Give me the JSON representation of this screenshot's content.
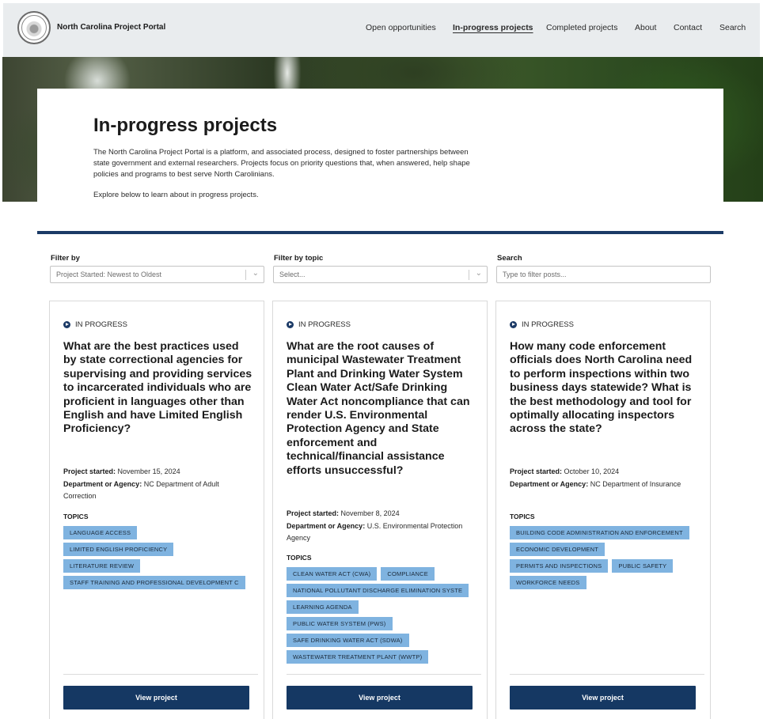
{
  "header": {
    "brand": "North Carolina Project Portal",
    "nav": [
      "Open opportunities",
      "In-progress projects",
      "Completed projects",
      "About",
      "Contact",
      "Search"
    ],
    "active_nav": "In-progress projects"
  },
  "hero": {
    "title": "In-progress projects",
    "description": "The North Carolina Project Portal is a platform, and associated process, designed to foster partnerships between state government and external researchers. Projects focus on priority questions that, when answered, help shape policies and programs to best serve North Carolinians.",
    "explore": "Explore below to learn about in progress projects."
  },
  "filters": {
    "filter_by": {
      "label": "Filter by",
      "value": "Project Started: Newest to Oldest"
    },
    "topic": {
      "label": "Filter by topic",
      "placeholder": "Select..."
    },
    "search": {
      "label": "Search",
      "placeholder": "Type to filter posts..."
    }
  },
  "labels": {
    "started": "Project started:",
    "agency": "Department or Agency:",
    "topics": "TOPICS",
    "view": "View project"
  },
  "cards": [
    {
      "status": "IN PROGRESS",
      "title": "What are the best practices used by state correctional agencies for supervising and providing services to incarcerated individuals who are proficient in languages other than English and have Limited English Proficiency?",
      "started": "November 15, 2024",
      "agency": "NC Department of Adult Correction",
      "tags": [
        [
          "LANGUAGE ACCESS"
        ],
        [
          "LIMITED ENGLISH PROFICIENCY"
        ],
        [
          "LITERATURE REVIEW"
        ],
        [
          "STAFF TRAINING AND PROFESSIONAL DEVELOPMENT C"
        ]
      ]
    },
    {
      "status": "IN PROGRESS",
      "title": "What are the root causes of municipal Wastewater Treatment Plant and Drinking Water System Clean Water Act/Safe Drinking Water Act noncompliance that can render U.S. Environmental Protection Agency and State enforcement and technical/financial assistance efforts unsuccessful?",
      "started": "November 8, 2024",
      "agency": "U.S. Environmental Protection Agency",
      "tags": [
        [
          "CLEAN WATER ACT (CWA)",
          "COMPLIANCE"
        ],
        [
          "NATIONAL POLLUTANT DISCHARGE ELIMINATION SYSTE"
        ],
        [
          "LEARNING AGENDA"
        ],
        [
          "PUBLIC WATER SYSTEM (PWS)"
        ],
        [
          "SAFE DRINKING WATER ACT (SDWA)"
        ],
        [
          "WASTEWATER TREATMENT PLANT (WWTP)"
        ]
      ]
    },
    {
      "status": "IN PROGRESS",
      "title": "How many code enforcement officials does North Carolina need to perform inspections within two business days statewide? What is the best methodology and tool for optimally allocating inspectors across the state?",
      "started": "October 10, 2024",
      "agency": "NC Department of Insurance",
      "tags": [
        [
          "BUILDING CODE ADMINISTRATION AND ENFORCEMENT"
        ],
        [
          "ECONOMIC DEVELOPMENT"
        ],
        [
          "PERMITS AND INSPECTIONS",
          "PUBLIC SAFETY"
        ],
        [
          "WORKFORCE NEEDS"
        ]
      ]
    }
  ]
}
